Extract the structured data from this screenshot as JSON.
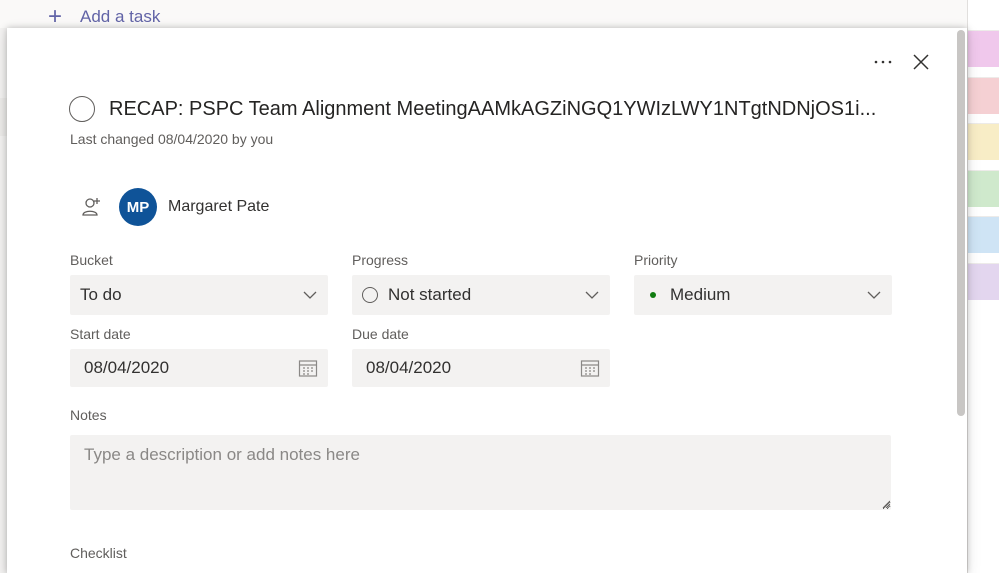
{
  "board": {
    "add_task_label": "Add a task",
    "label_colors": [
      "#f0c8ec",
      "#f5d0d3",
      "#f8edc6",
      "#cfe9cc",
      "#cfe4f5",
      "#e3d6ef"
    ]
  },
  "task": {
    "title": "RECAP: PSPC Team Alignment MeetingAAMkAGZiNGQ1YWIzLWY1NTgtNDNjOS1i...",
    "last_changed": "Last changed 08/04/2020 by you"
  },
  "assignee": {
    "initials": "MP",
    "name": "Margaret Pate",
    "avatar_color": "#0f5398"
  },
  "fields": {
    "bucket": {
      "label": "Bucket",
      "value": "To do"
    },
    "progress": {
      "label": "Progress",
      "value": "Not started"
    },
    "priority": {
      "label": "Priority",
      "value": "Medium",
      "dot_color": "#107c10"
    },
    "start_date": {
      "label": "Start date",
      "value": "08/04/2020"
    },
    "due_date": {
      "label": "Due date",
      "value": "08/04/2020"
    }
  },
  "notes": {
    "label": "Notes",
    "placeholder": "Type a description or add notes here"
  },
  "checklist": {
    "label": "Checklist"
  },
  "icons": {
    "more": "more-options-icon",
    "close": "close-icon",
    "assign": "assign-person-icon",
    "chevron": "chevron-down-icon",
    "calendar": "calendar-icon"
  }
}
